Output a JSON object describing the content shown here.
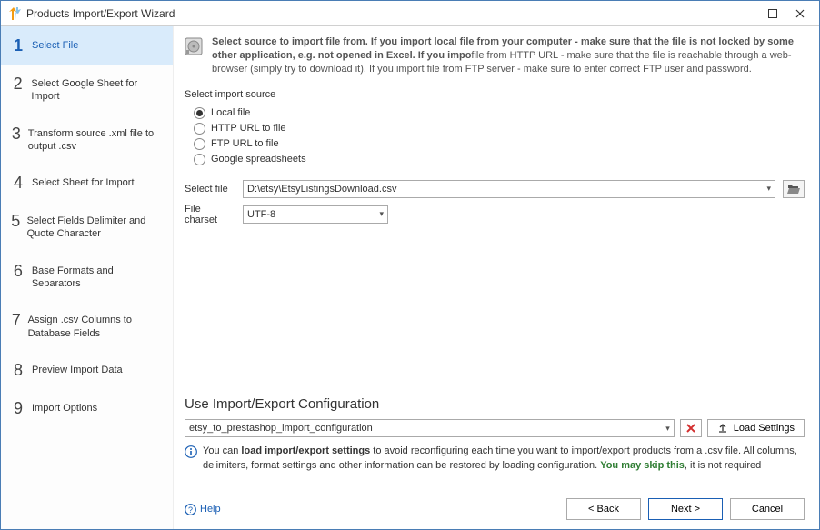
{
  "window": {
    "title": "Products Import/Export Wizard"
  },
  "steps": [
    {
      "num": "1",
      "label": "Select File",
      "active": true
    },
    {
      "num": "2",
      "label": "Select Google Sheet for Import"
    },
    {
      "num": "3",
      "label": "Transform source .xml file to output .csv"
    },
    {
      "num": "4",
      "label": "Select Sheet for Import"
    },
    {
      "num": "5",
      "label": "Select Fields Delimiter and Quote Character"
    },
    {
      "num": "6",
      "label": "Base Formats and Separators"
    },
    {
      "num": "7",
      "label": "Assign .csv Columns to Database Fields"
    },
    {
      "num": "8",
      "label": "Preview Import Data"
    },
    {
      "num": "9",
      "label": "Import Options"
    }
  ],
  "intro": {
    "part1": "Select source to import file from. If you import local file from your computer - make sure that the file is not locked by some other application, e.g. not opened in Excel. If you impo",
    "part2": "file from HTTP URL - make sure that the file is reachable through a web-browser (simply try to download it). If you import file from FTP server - make sure to enter correct FTP user and password."
  },
  "source": {
    "group_label": "Select import source",
    "options": {
      "local": "Local file",
      "http": "HTTP URL to file",
      "ftp": "FTP URL to file",
      "google": "Google spreadsheets"
    },
    "selected": "local"
  },
  "file": {
    "select_label": "Select file",
    "path": "D:\\etsy\\EtsyListingsDownload.csv",
    "charset_label": "File charset",
    "charset_value": "UTF-8"
  },
  "config": {
    "title": "Use Import/Export Configuration",
    "value": "etsy_to_prestashop_import_configuration",
    "load_label": "Load Settings",
    "info_pre": "You can ",
    "info_bold": "load import/export settings",
    "info_mid": " to avoid reconfiguring each time you want to import/export products from a .csv file. All columns, delimiters, format settings and other information can be restored by loading configuration. ",
    "info_green": "You may skip this",
    "info_post": ", it is not required"
  },
  "footer": {
    "help": "Help",
    "back": "< Back",
    "next": "Next >",
    "cancel": "Cancel"
  }
}
